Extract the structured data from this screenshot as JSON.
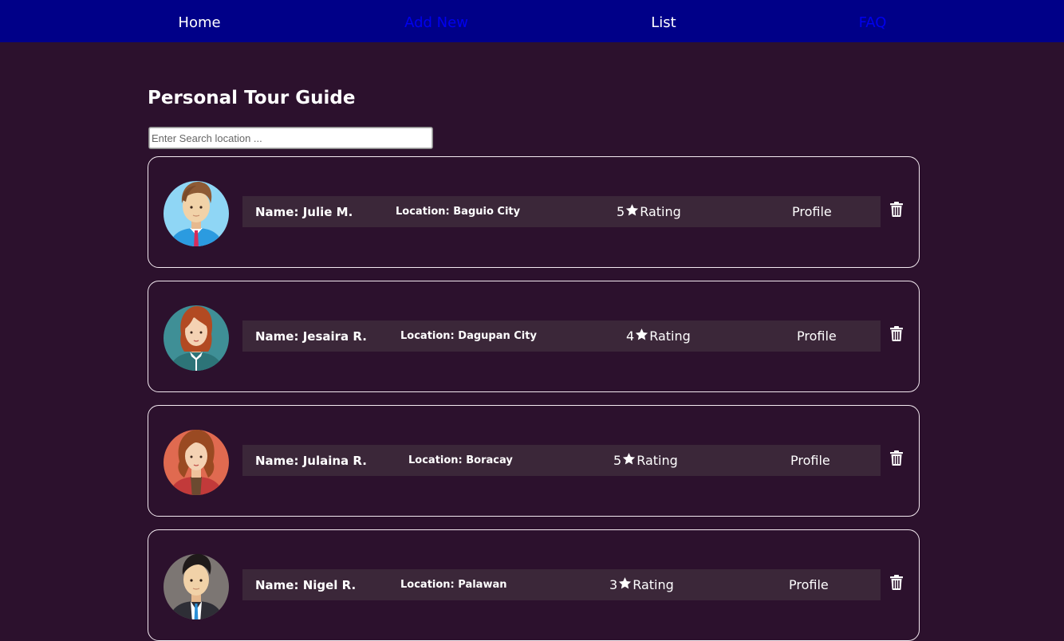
{
  "nav": {
    "items": [
      {
        "label": "Home"
      },
      {
        "label": "Add New"
      },
      {
        "label": "List"
      },
      {
        "label": "FAQ"
      }
    ]
  },
  "page": {
    "title": "Personal Tour Guide"
  },
  "search": {
    "placeholder": "Enter Search location ...",
    "value": ""
  },
  "guides": [
    {
      "name": "Name: Julie M.",
      "location": "Location: Baguio City",
      "rating": "5",
      "rating_label": "Rating",
      "profile_label": "Profile",
      "avatar": "male-guide-avatar"
    },
    {
      "name": "Name: Jesaira R.",
      "location": "Location: Dagupan City",
      "rating": "4",
      "rating_label": "Rating",
      "profile_label": "Profile",
      "avatar": "female-guide-avatar"
    },
    {
      "name": "Name: Julaina R.",
      "location": "Location: Boracay",
      "rating": "5",
      "rating_label": "Rating",
      "profile_label": "Profile",
      "avatar": "female-guide-avatar"
    },
    {
      "name": "Name: Nigel R.",
      "location": "Location: Palawan",
      "rating": "3",
      "rating_label": "Rating",
      "profile_label": "Profile",
      "avatar": "male-guide-avatar"
    }
  ],
  "icons": {
    "rating": "star-icon",
    "delete": "trash-icon"
  },
  "colors": {
    "background": "#2c112d",
    "navbar": "#000088",
    "nav_active_link": "#ffffff",
    "nav_unvisited_link": "#0000ee",
    "info_bar": "#3b2739",
    "card_border": "#f3e9f0"
  }
}
